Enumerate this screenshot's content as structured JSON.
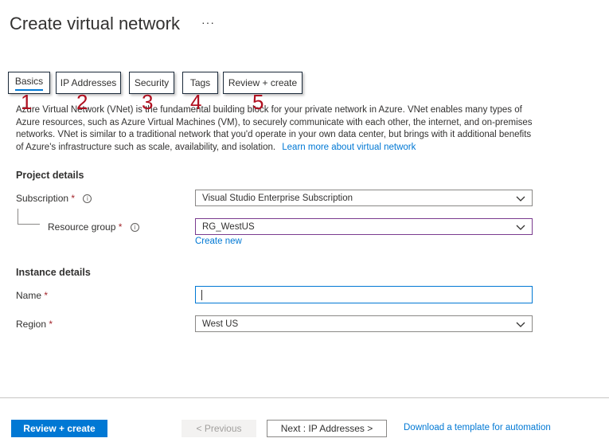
{
  "page": {
    "title": "Create virtual network",
    "more_label": "···"
  },
  "tabs": [
    {
      "label": "Basics",
      "number": "1"
    },
    {
      "label": "IP Addresses",
      "number": "2"
    },
    {
      "label": "Security",
      "number": "3"
    },
    {
      "label": "Tags",
      "number": "4"
    },
    {
      "label": "Review + create",
      "number": "5"
    }
  ],
  "intro": {
    "text": "Azure Virtual Network (VNet) is the fundamental building block for your private network in Azure. VNet enables many types of Azure resources, such as Azure Virtual Machines (VM), to securely communicate with each other, the internet, and on-premises networks. VNet is similar to a traditional network that you'd operate in your own data center, but brings with it additional benefits of Azure's infrastructure such as scale, availability, and isolation.",
    "link": "Learn more about virtual network"
  },
  "project": {
    "heading": "Project details",
    "subscription_label": "Subscription",
    "subscription_value": "Visual Studio Enterprise Subscription",
    "resource_group_label": "Resource group",
    "resource_group_value": "RG_WestUS",
    "create_new": "Create new"
  },
  "instance": {
    "heading": "Instance details",
    "name_label": "Name",
    "name_value": "",
    "region_label": "Region",
    "region_value": "West US"
  },
  "required_marker": "*",
  "info_glyph": "i",
  "footer": {
    "review_create": "Review + create",
    "previous": "< Previous",
    "next": "Next : IP Addresses >",
    "download": "Download a template for automation"
  },
  "colors": {
    "accent": "#0078d4",
    "annotation": "#b01020",
    "required": "#a4262c"
  }
}
